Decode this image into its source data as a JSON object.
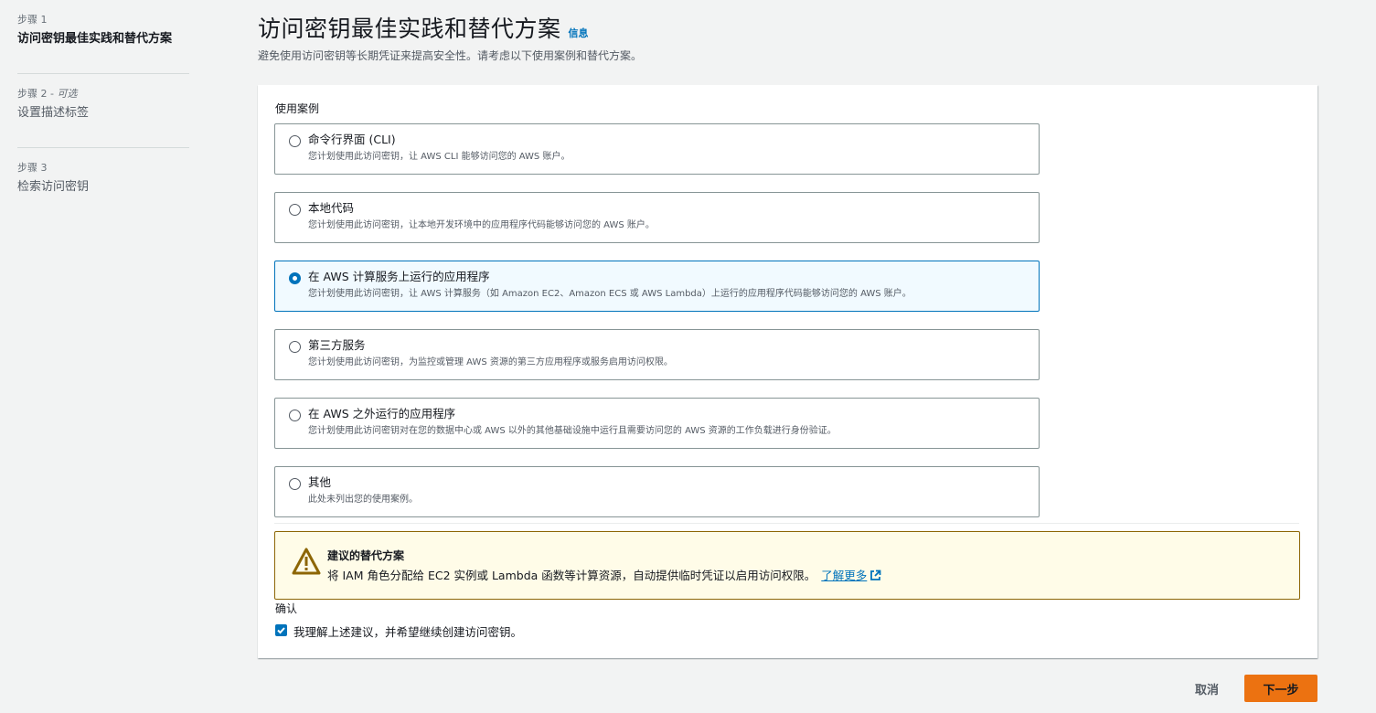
{
  "sidebar": {
    "steps": [
      {
        "number": "步骤 1",
        "optional": "",
        "title": "访问密钥最佳实践和替代方案"
      },
      {
        "number": "步骤 2 - ",
        "optional": "可选",
        "title": "设置描述标签"
      },
      {
        "number": "步骤 3",
        "optional": "",
        "title": "检索访问密钥"
      }
    ]
  },
  "header": {
    "title": "访问密钥最佳实践和替代方案",
    "info_link": "信息",
    "description": "避免使用访问密钥等长期凭证来提高安全性。请考虑以下使用案例和替代方案。"
  },
  "use_cases": {
    "label": "使用案例",
    "selected_index": 2,
    "options": [
      {
        "title": "命令行界面 (CLI)",
        "description": "您计划使用此访问密钥，让 AWS CLI 能够访问您的 AWS 账户。"
      },
      {
        "title": "本地代码",
        "description": "您计划使用此访问密钥，让本地开发环境中的应用程序代码能够访问您的 AWS 账户。"
      },
      {
        "title": "在 AWS 计算服务上运行的应用程序",
        "description": "您计划使用此访问密钥，让 AWS 计算服务（如 Amazon EC2、Amazon ECS 或 AWS Lambda）上运行的应用程序代码能够访问您的 AWS 账户。"
      },
      {
        "title": "第三方服务",
        "description": "您计划使用此访问密钥，为监控或管理 AWS 资源的第三方应用程序或服务启用访问权限。"
      },
      {
        "title": "在 AWS 之外运行的应用程序",
        "description": "您计划使用此访问密钥对在您的数据中心或 AWS 以外的其他基础设施中运行且需要访问您的 AWS 资源的工作负载进行身份验证。"
      },
      {
        "title": "其他",
        "description": "此处未列出您的使用案例。"
      }
    ]
  },
  "alert": {
    "title": "建议的替代方案",
    "body": "将 IAM 角色分配给 EC2 实例或 Lambda 函数等计算资源，自动提供临时凭证以启用访问权限。",
    "link": "了解更多",
    "icon": "warning-icon",
    "color": "#8d6605"
  },
  "confirm": {
    "label": "确认",
    "checkbox_label": "我理解上述建议，并希望继续创建访问密钥。",
    "checked": true
  },
  "footer": {
    "cancel": "取消",
    "next": "下一步"
  },
  "colors": {
    "accent": "#0073bb",
    "primary_button": "#ec7211",
    "alert_background": "#fffce8"
  }
}
